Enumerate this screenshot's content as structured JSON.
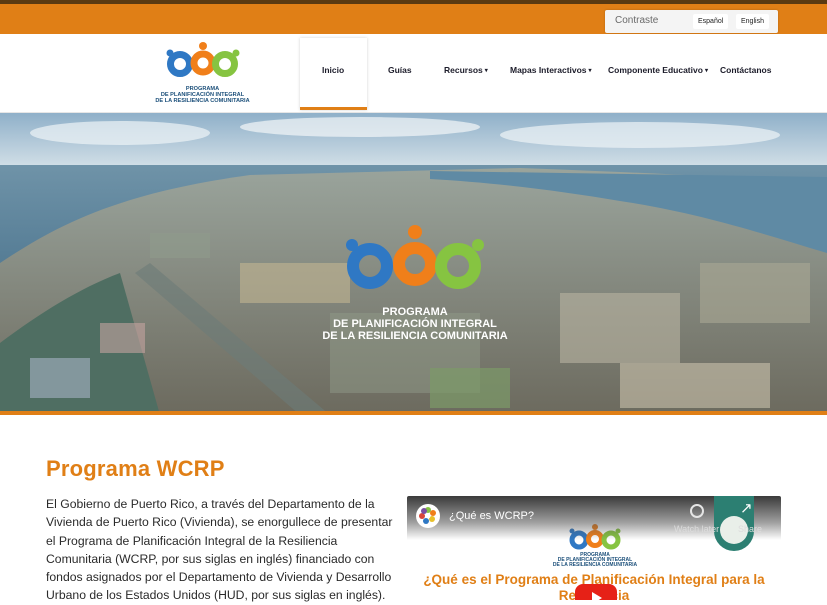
{
  "colors": {
    "brand_orange": "#e07f16",
    "logo_blue": "#2f78c4",
    "logo_green": "#86c441",
    "logo_orange": "#f07f1a",
    "logo_text": "#1b4f7a"
  },
  "toolbar": {
    "contrast_label": "Contraste",
    "lang_es": "Español",
    "lang_en": "English"
  },
  "logo": {
    "line1": "PROGRAMA",
    "line2": "DE PLANIFICACIÓN INTEGRAL",
    "line3": "DE LA RESILIENCIA COMUNITARIA"
  },
  "nav": {
    "items": [
      {
        "label": "Inicio"
      },
      {
        "label": "Guías"
      },
      {
        "label": "Recursos"
      },
      {
        "label": "Mapas Interactivos"
      },
      {
        "label": "Componente Educativo"
      },
      {
        "label": "Contáctanos"
      }
    ]
  },
  "hero": {
    "image": "aerial-city-coast-photo"
  },
  "main": {
    "title": "Programa WCRP",
    "intro": "El Gobierno de Puerto Rico, a través del Departamento de la Vivienda de Puerto Rico (Vivienda), se enorgullece de presentar el Programa de Planificación Integral de la Resiliencia Comunitaria (WCRP, por sus siglas en inglés) financiado con fondos asignados por el Departamento de Vivienda y Desarrollo Urbano de los Estados Unidos (HUD, por sus siglas en inglés)."
  },
  "video": {
    "title": "¿Qué es WCRP?",
    "watch_later": "Watch later",
    "share": "Share",
    "headline": "¿Qué es el Programa de Planificación Integral para la Resiliencia"
  }
}
